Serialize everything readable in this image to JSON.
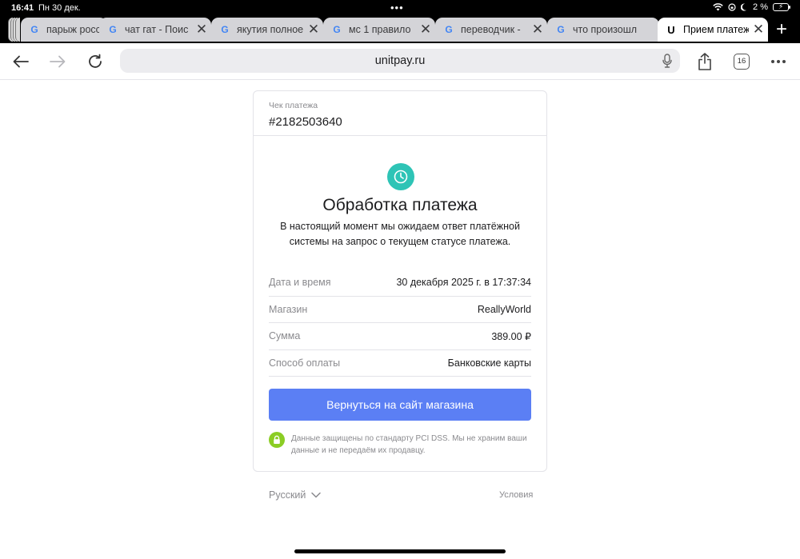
{
  "status_bar": {
    "time": "16:41",
    "date": "Пн 30 дек.",
    "battery": "2 %"
  },
  "tabs": [
    {
      "title": "парыж росс",
      "icon": "google-icon",
      "active": false
    },
    {
      "title": "чат гат - Поис",
      "icon": "google-icon",
      "active": false
    },
    {
      "title": "якутия полное",
      "icon": "google-icon",
      "active": false
    },
    {
      "title": "мс 1 правило",
      "icon": "google-icon",
      "active": false
    },
    {
      "title": "переводчик -",
      "icon": "google-icon",
      "active": false
    },
    {
      "title": "что произошл",
      "icon": "google-icon",
      "active": false
    },
    {
      "title": "Прием платеж",
      "icon": "unitpay-icon",
      "active": true
    }
  ],
  "toolbar": {
    "url": "unitpay.ru",
    "tab_count": "16"
  },
  "receipt": {
    "label": "Чек платежа",
    "number": "#2182503640"
  },
  "status": {
    "title": "Обработка платежа",
    "description": "В настоящий момент мы ожидаем ответ платёжной системы на запрос о текущем статусе платежа."
  },
  "details": [
    {
      "label": "Дата и время",
      "value": "30 декабря 2025 г. в 17:37:34"
    },
    {
      "label": "Магазин",
      "value": "ReallyWorld"
    },
    {
      "label": "Сумма",
      "value": "389.00 ₽"
    },
    {
      "label": "Способ оплаты",
      "value": "Банковские карты"
    }
  ],
  "return_button": "Вернуться на сайт магазина",
  "security_note": "Данные защищены по стандарту PCI DSS. Мы не храним ваши данные и не передаём их продавцу.",
  "footer": {
    "language": "Русский",
    "terms": "Условия"
  },
  "colors": {
    "accent": "#5b7ff4",
    "status_icon": "#2ec4b6",
    "lock_icon": "#8bcd24"
  }
}
